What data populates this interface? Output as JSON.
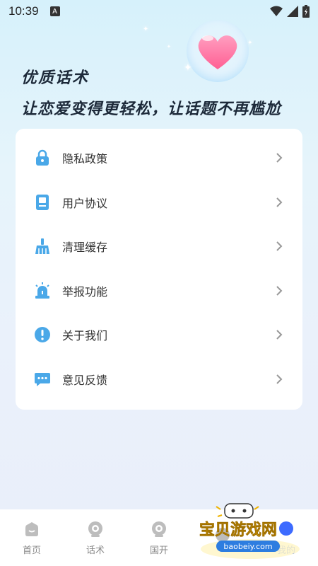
{
  "status_bar": {
    "time": "10:39",
    "notification_glyph": "A"
  },
  "hero": {
    "line1": "优质话术",
    "line2": "让恋爱变得更轻松，让话题不再尴尬"
  },
  "menu": {
    "items": [
      {
        "label": "隐私政策",
        "icon": "lock-icon"
      },
      {
        "label": "用户协议",
        "icon": "document-icon"
      },
      {
        "label": "清理缓存",
        "icon": "broom-icon"
      },
      {
        "label": "举报功能",
        "icon": "alarm-light-icon"
      },
      {
        "label": "关于我们",
        "icon": "info-icon"
      },
      {
        "label": "意见反馈",
        "icon": "chat-bubble-icon"
      }
    ]
  },
  "tabbar": {
    "tabs": [
      {
        "label": "首页",
        "active": false
      },
      {
        "label": "话术",
        "active": false
      },
      {
        "label": "国开",
        "active": false
      },
      {
        "label": "",
        "active": false
      },
      {
        "label": "我的",
        "active": true
      }
    ]
  },
  "watermark": {
    "title": "宝贝游戏网",
    "url": "baobeiy.com"
  },
  "colors": {
    "accent": "#3d6bff",
    "icon_blue": "#4aa8e8",
    "text": "#333333"
  }
}
